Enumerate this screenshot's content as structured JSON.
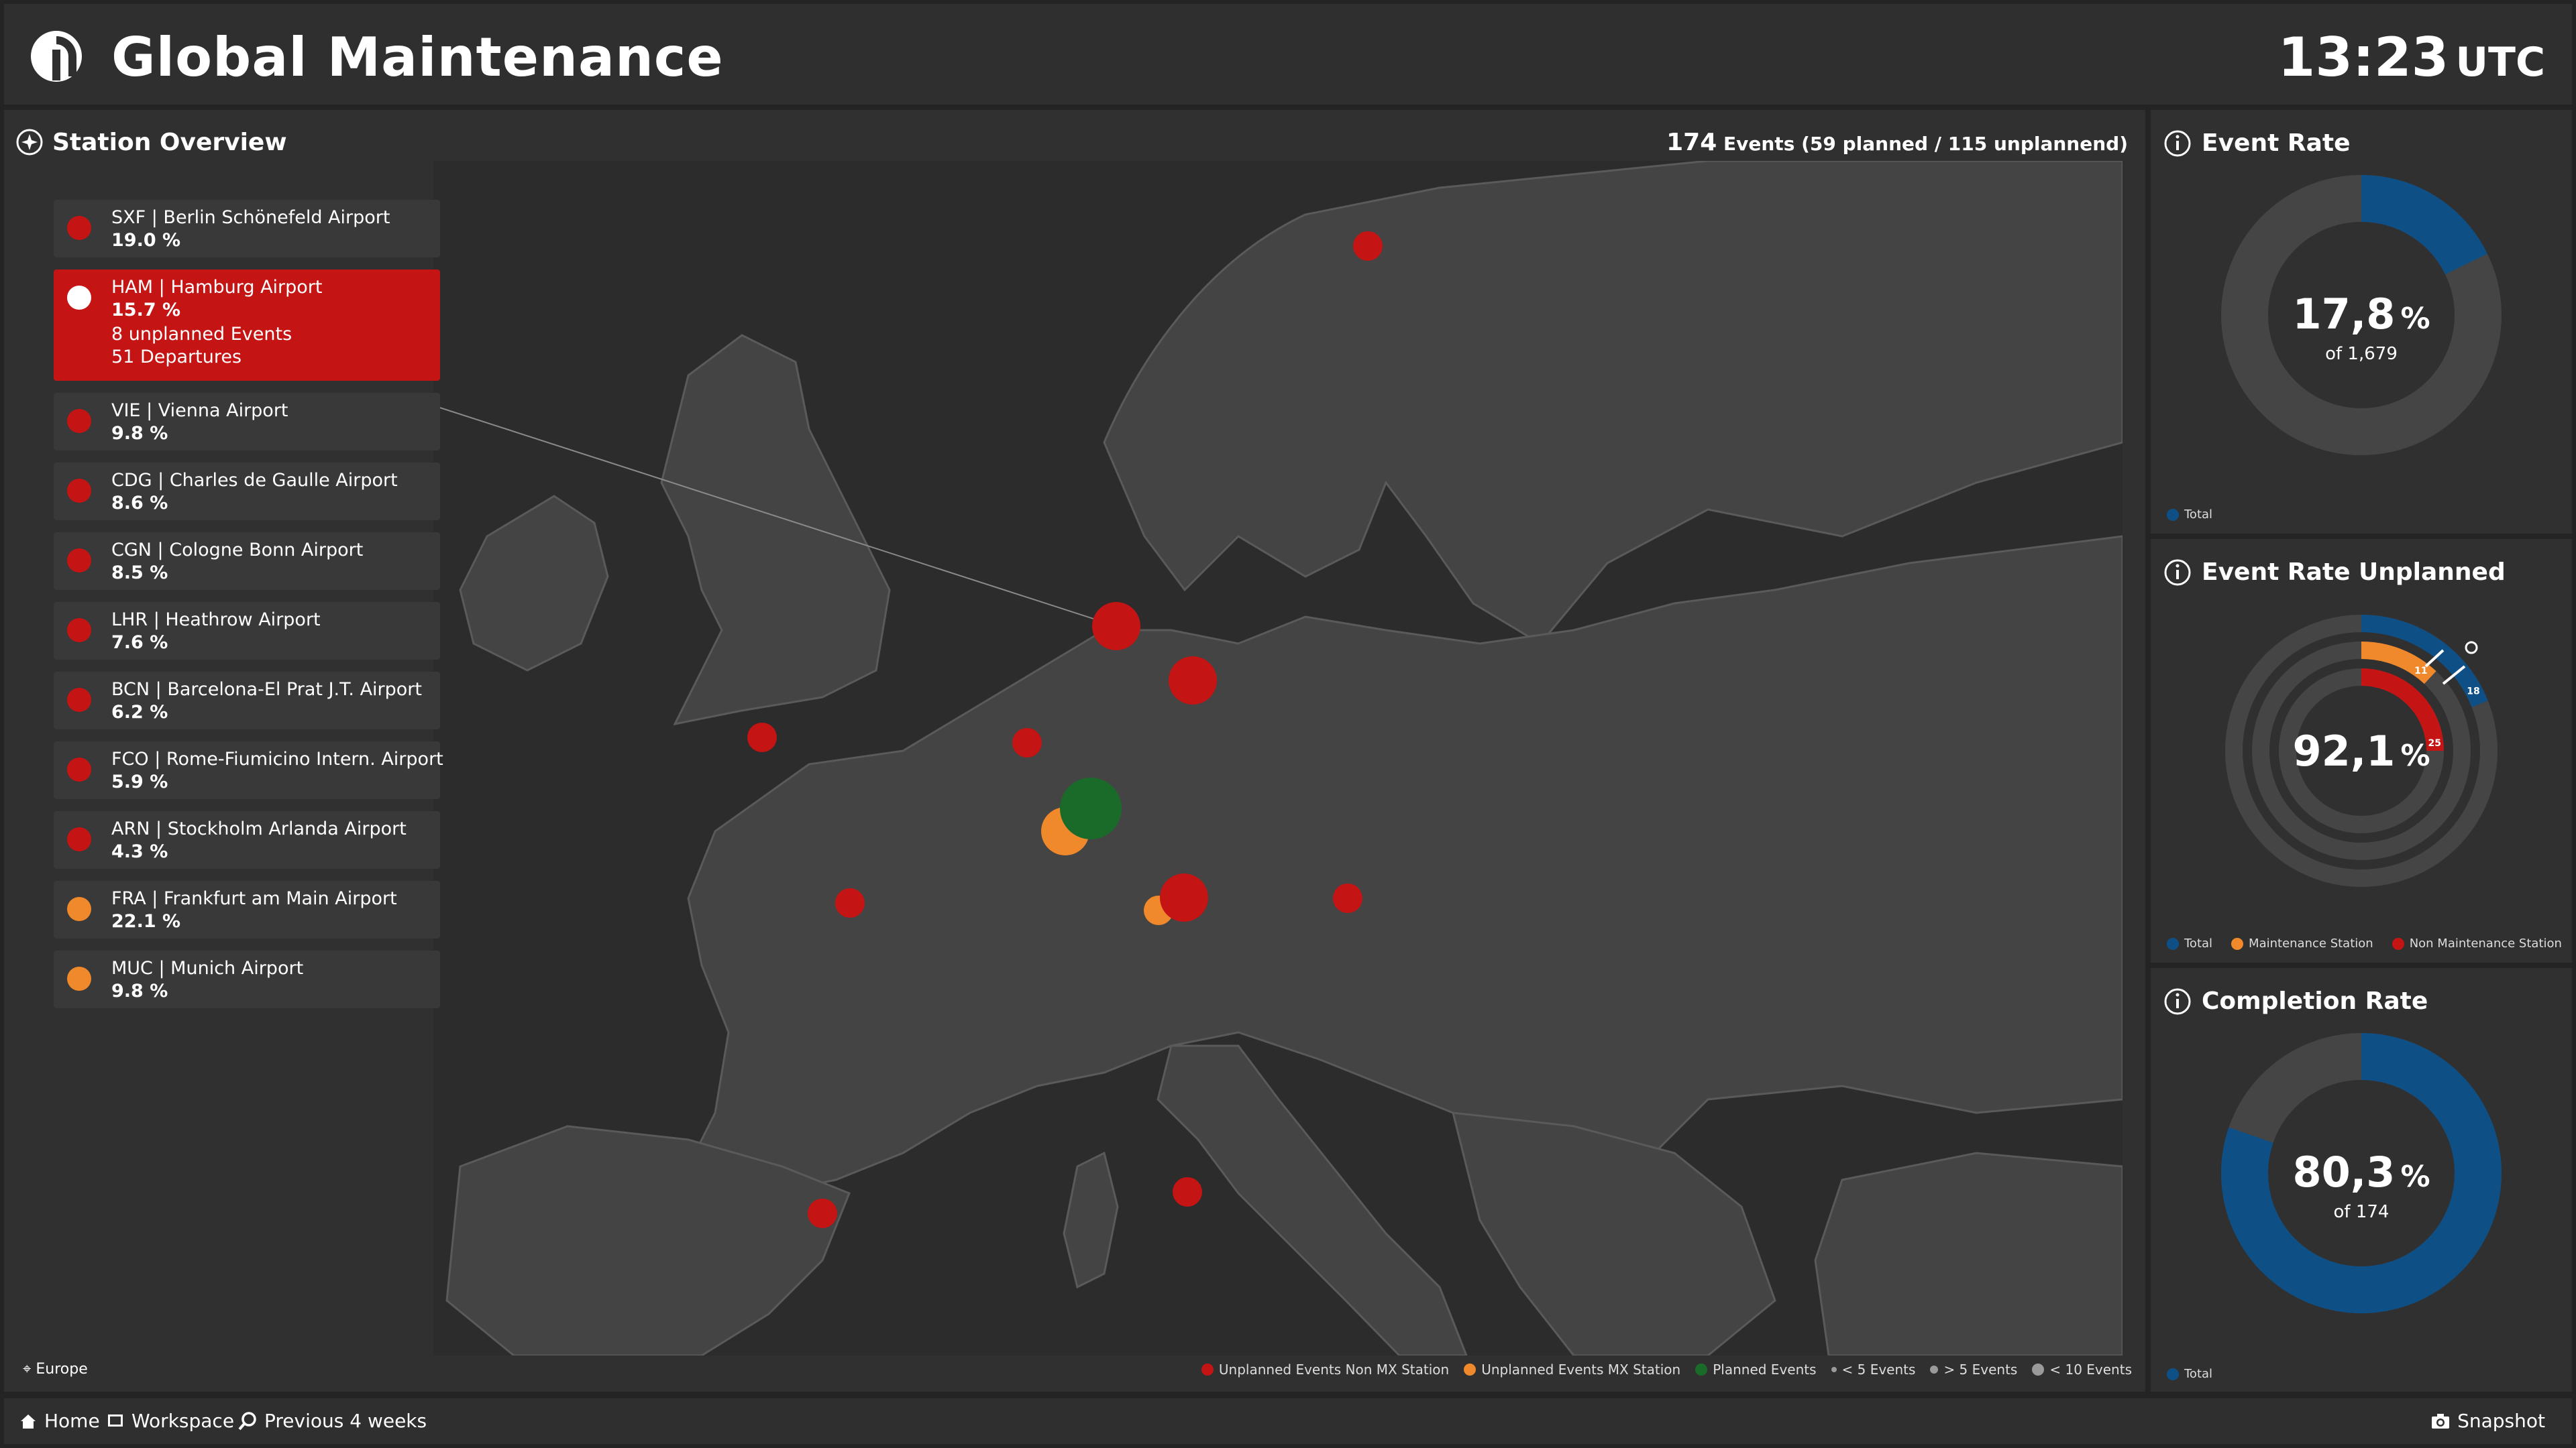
{
  "header": {
    "title": "Global Maintenance",
    "time": "13:23",
    "timezone": "UTC"
  },
  "station_overview": {
    "title": "Station Overview",
    "events_total": "174",
    "events_detail": "Events (59 planned / 115 unplannend)",
    "region": "Europe",
    "stations": [
      {
        "name": "SXF | Berlin Schönefeld Airport",
        "pct": "19.0 %",
        "type": "unplanned"
      },
      {
        "name": "HAM | Hamburg Airport",
        "pct": "15.7 %",
        "type": "unplanned",
        "active": true,
        "extra1": "8 unplanned Events",
        "extra2": "51 Departures"
      },
      {
        "name": "VIE | Vienna Airport",
        "pct": "9.8 %",
        "type": "unplanned"
      },
      {
        "name": "CDG | Charles de Gaulle Airport",
        "pct": "8.6 %",
        "type": "unplanned"
      },
      {
        "name": "CGN | Cologne Bonn Airport",
        "pct": "8.5 %",
        "type": "unplanned"
      },
      {
        "name": "LHR | Heathrow Airport",
        "pct": "7.6 %",
        "type": "unplanned"
      },
      {
        "name": "BCN | Barcelona-El Prat J.T. Airport",
        "pct": "6.2 %",
        "type": "unplanned"
      },
      {
        "name": "FCO | Rome-Fiumicino Intern. Airport",
        "pct": "5.9 %",
        "type": "unplanned"
      },
      {
        "name": "ARN | Stockholm Arlanda Airport",
        "pct": "4.3 %",
        "type": "unplanned"
      },
      {
        "name": "FRA | Frankfurt am Main Airport",
        "pct": "22.1 %",
        "type": "mx"
      },
      {
        "name": "MUC | Munich Airport",
        "pct": "9.8 %",
        "type": "mx"
      }
    ],
    "legend": [
      {
        "label": "Unplanned Events Non MX Station",
        "color": "#c41414"
      },
      {
        "label": "Unplanned Events MX Station",
        "color": "#f0892c"
      },
      {
        "label": "Planned Events",
        "color": "#1a6b2a"
      },
      {
        "label": "< 5 Events",
        "color": "#9a9a9a"
      },
      {
        "label": "> 5 Events",
        "color": "#9a9a9a"
      },
      {
        "label": "< 10 Events",
        "color": "#9a9a9a"
      }
    ]
  },
  "event_rate": {
    "title": "Event Rate",
    "value": "17,8",
    "unit": "%",
    "sub": "of  1,679",
    "fraction": 0.178,
    "legend": [
      {
        "label": "Total",
        "color": "#0e4f86"
      }
    ]
  },
  "event_rate_unplanned": {
    "title": "Event Rate Unplanned",
    "value": "92,1",
    "unit": "%",
    "rings": [
      {
        "label": "Total",
        "color": "#0e4f86",
        "fraction": 0.19,
        "badge": "18"
      },
      {
        "label": "Maintenance Station",
        "color": "#f0892c",
        "fraction": 0.12,
        "badge": "11"
      },
      {
        "label": "Non Maintenance Station",
        "color": "#c41414",
        "fraction": 0.25,
        "badge": "25"
      }
    ],
    "legend": [
      {
        "label": "Total",
        "color": "#0e4f86"
      },
      {
        "label": "Maintenance Station",
        "color": "#f0892c"
      },
      {
        "label": "Non Maintenance Station",
        "color": "#c41414"
      }
    ]
  },
  "completion_rate": {
    "title": "Completion Rate",
    "value": "80,3",
    "unit": "%",
    "sub": "of 174",
    "fraction": 0.803,
    "legend": [
      {
        "label": "Total",
        "color": "#0e4f86"
      }
    ]
  },
  "footer": {
    "home": "Home",
    "workspace": "Workspace",
    "range": "Previous 4 weeks",
    "snapshot": "Snapshot"
  },
  "colors": {
    "unplanned": "#c41414",
    "mx": "#f0892c",
    "planned": "#1a6b2a",
    "total": "#0e4f86",
    "ring_bg": "#454545"
  }
}
